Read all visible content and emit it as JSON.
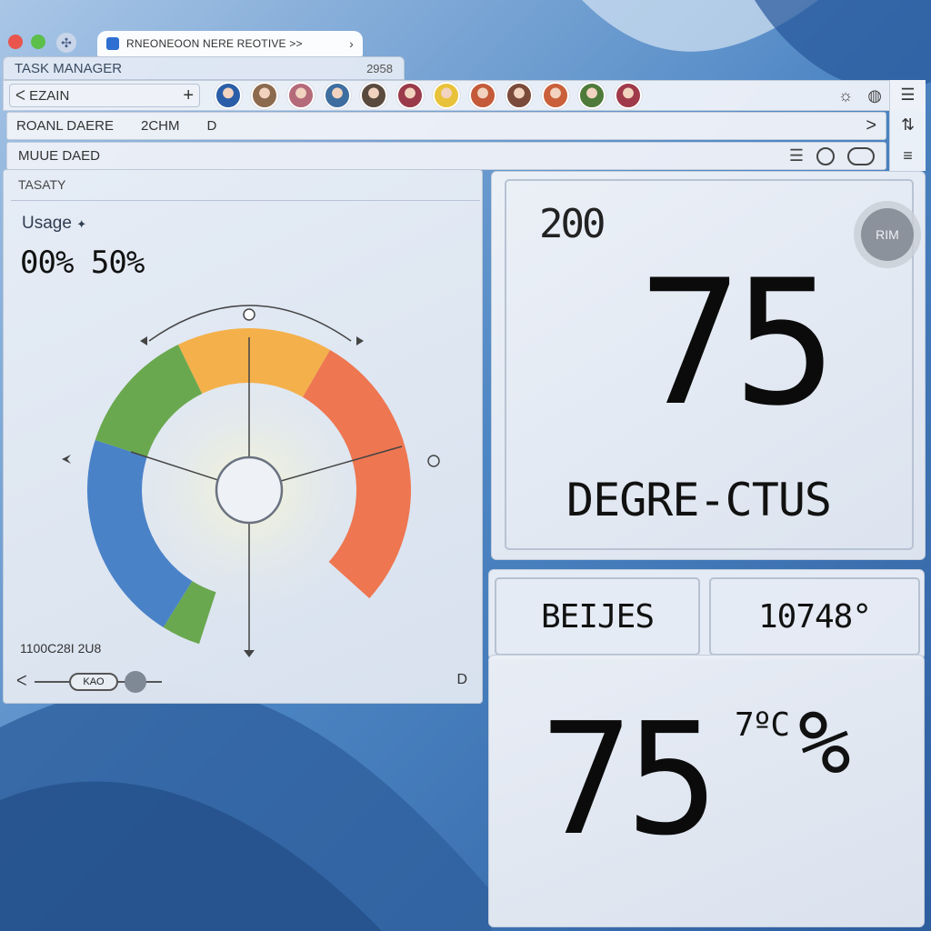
{
  "browser": {
    "tab_title": "RNEONEOON NERE REOTIVE >>",
    "tab_close": "›"
  },
  "window": {
    "title": "TASK MANAGER",
    "title_code": "2958"
  },
  "toolbar": {
    "back_label": "ᐸ EZAIN",
    "add_label": "+",
    "avatar_colors": [
      "#2b5ea8",
      "#8c6a4e",
      "#b56a7a",
      "#3e6ea0",
      "#5a4a3e",
      "#9a3a4a",
      "#e8c23a",
      "#c45a3a",
      "#7a4a3a",
      "#c9603a",
      "#4f7a3a",
      "#a03a4a"
    ]
  },
  "address_row": {
    "left": "ROANL DAERE",
    "mid": "2CHM",
    "mid_icon": "D",
    "chevron": ">"
  },
  "filter_row": {
    "label": "MUUE DAED"
  },
  "left_panel": {
    "header": "TASATY",
    "usage_label": "Usage",
    "usage_mark": "✦",
    "usage_value": "00% 50%",
    "footer": "1100C28I 2U8",
    "slider_label": "KAO",
    "slider_end": "D"
  },
  "right_top": {
    "small_value": "200",
    "big_value": "75",
    "unit": "DEGRE-CTUS",
    "button_label": "RIM"
  },
  "right_middle": {
    "left_label": "BEIJES",
    "right_value": "10748°"
  },
  "right_bottom": {
    "big_value": "75",
    "small_value": "7ºC",
    "percent": "%"
  },
  "gauge": {
    "segments": [
      {
        "color": "#4a82c8"
      },
      {
        "color": "#6aa84f"
      },
      {
        "color": "#f4b04a"
      },
      {
        "color": "#ee7650"
      }
    ]
  },
  "colors": {
    "accent": "#2e6fd1",
    "wallpaper": "#3f78b8"
  }
}
